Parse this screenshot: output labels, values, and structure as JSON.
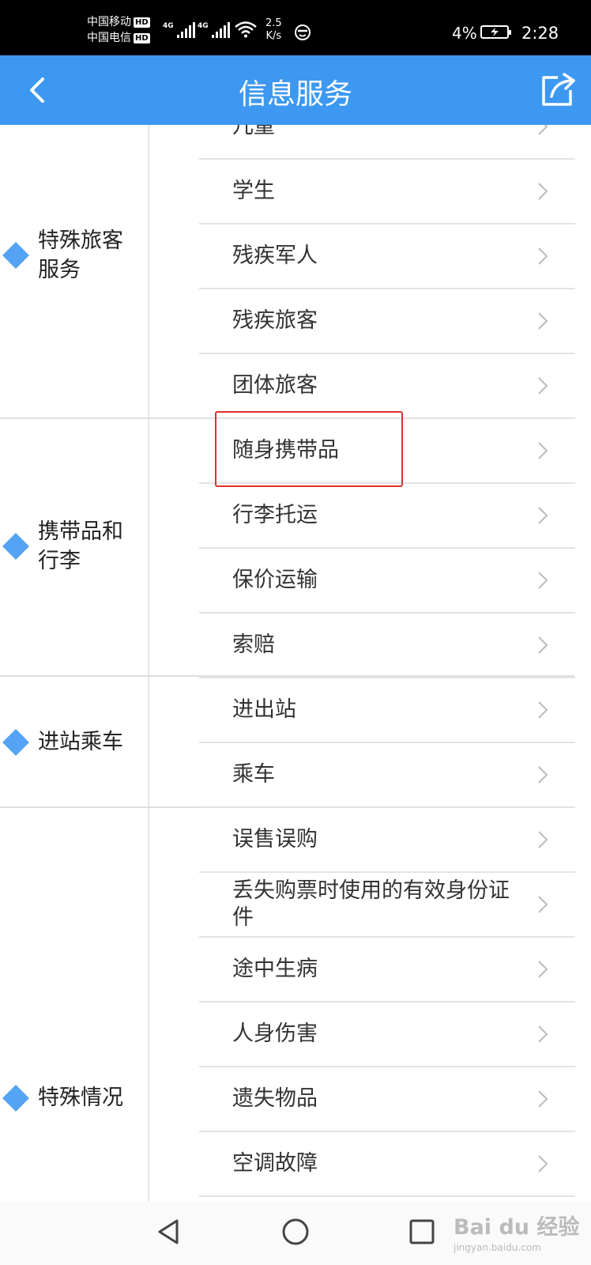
{
  "status_bar": {
    "carrier1": "中国移动",
    "carrier2": "中国电信",
    "hd_badge": "HD",
    "network": "4G",
    "speed_value": "2.5",
    "speed_unit": "K/s",
    "battery": "4%",
    "time": "2:28"
  },
  "header": {
    "title": "信息服务",
    "back_icon": "chevron-left-icon",
    "share_icon": "share-icon"
  },
  "categories": [
    {
      "label": "特殊旅客服务"
    },
    {
      "label": "携带品和行李"
    },
    {
      "label": "进站乘车"
    },
    {
      "label": "特殊情况"
    }
  ],
  "rows": [
    {
      "label": "儿童"
    },
    {
      "label": "学生"
    },
    {
      "label": "残疾军人"
    },
    {
      "label": "残疾旅客"
    },
    {
      "label": "团体旅客"
    },
    {
      "label": "随身携带品"
    },
    {
      "label": "行李托运"
    },
    {
      "label": "保价运输"
    },
    {
      "label": "索赔"
    },
    {
      "label": "进出站"
    },
    {
      "label": "乘车"
    },
    {
      "label": "误售误购"
    },
    {
      "label": "丢失购票时使用的有效身份证件"
    },
    {
      "label": "途中生病"
    },
    {
      "label": "人身伤害"
    },
    {
      "label": "遗失物品"
    },
    {
      "label": "空调故障"
    }
  ],
  "watermark": {
    "line1": "Bai du 经验",
    "line2": "jingyan.baidu.com"
  },
  "colors": {
    "accent": "#3c98f0",
    "diamond": "#55a3f5",
    "highlight": "#e0322e"
  }
}
